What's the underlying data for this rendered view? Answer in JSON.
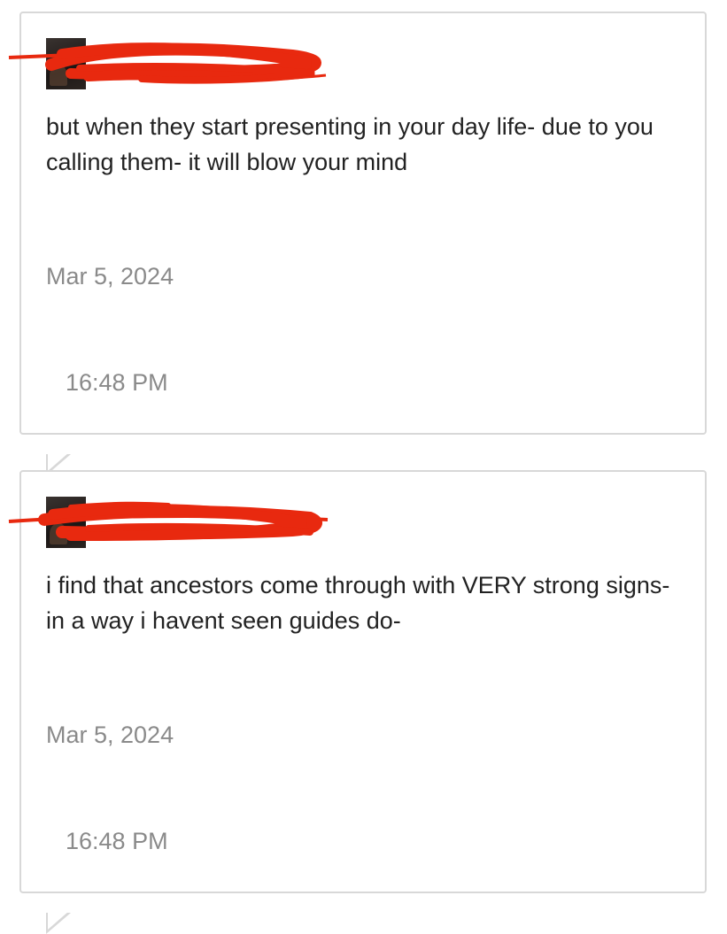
{
  "messages": [
    {
      "text": "but when they start presenting in your day life- due to you calling them- it will blow your mind",
      "date": "Mar 5, 2024",
      "time": "16:48 PM",
      "author_redacted": true,
      "redaction_color": "#e8290f"
    },
    {
      "text": "i find that ancestors come through with VERY strong signs- in a way i havent seen guides do-",
      "date": "Mar 5, 2024",
      "time": "16:48 PM",
      "author_redacted": true,
      "redaction_color": "#e8290f"
    }
  ],
  "colors": {
    "card_border": "#d8d8d8",
    "message_text": "#222222",
    "meta_text": "#8a8a8a"
  }
}
